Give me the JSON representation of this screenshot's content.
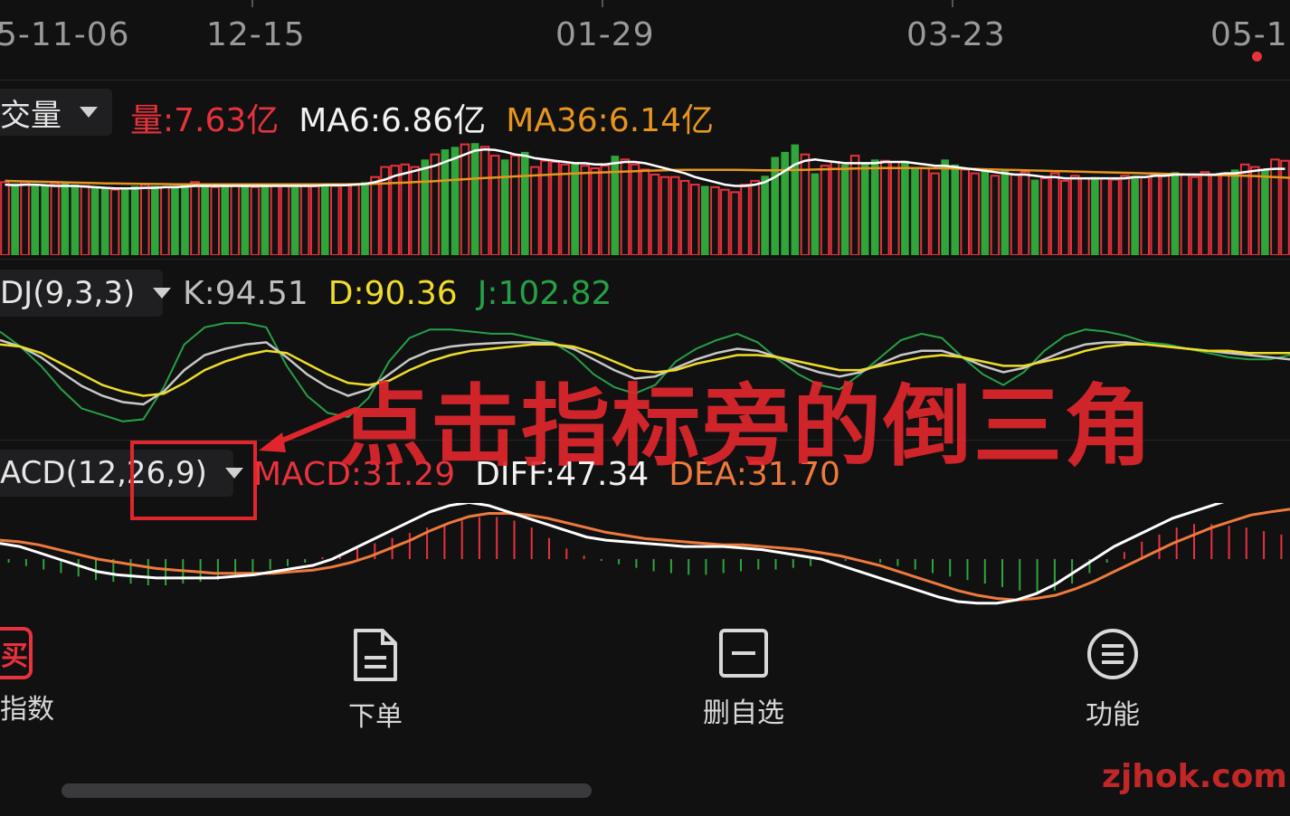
{
  "date_axis": {
    "labels": [
      "5-11-06",
      "12-15",
      "01-29",
      "03-23",
      "05-1"
    ]
  },
  "volume_panel": {
    "selector": "交量",
    "vol_label": "量:7.63亿",
    "ma6_label": "MA6:6.86亿",
    "ma36_label": "MA36:6.14亿"
  },
  "kdj_panel": {
    "selector": "DJ(9,3,3)",
    "k_label": "K:94.51",
    "d_label": "D:90.36",
    "j_label": "J:102.82"
  },
  "macd_panel": {
    "selector": "ACD(12,26,9)",
    "macd_label": "MACD:31.29",
    "diff_label": "DIFF:47.34",
    "dea_label": "DEA:31.70"
  },
  "annotation": {
    "text": "点击指标旁的倒三角"
  },
  "bottom_nav": {
    "index": {
      "icon_char": "买",
      "label": "指数"
    },
    "order": {
      "label": "下单"
    },
    "remove": {
      "label": "删自选"
    },
    "func": {
      "label": "功能"
    }
  },
  "watermark": "zjhok.com",
  "colors": {
    "up": "#e8323c",
    "down": "#2fa53a",
    "ma6": "#ffffff",
    "ma36": "#e6961e",
    "kdj_k": "#c8c8c8",
    "kdj_d": "#f0dc28",
    "kdj_j": "#26a046",
    "macd_diff": "#ffffff",
    "macd_dea": "#ee7a3c",
    "annotation": "#e0262c"
  },
  "chart_data": [
    {
      "type": "bar",
      "name": "volume",
      "unit": "亿",
      "latest": {
        "volume": 7.63,
        "MA6": 6.86,
        "MA36": 6.14
      },
      "values": [
        5.8,
        5.7,
        5.8,
        5.6,
        5.5,
        5.7,
        5.8,
        5.6,
        5.5,
        5.4,
        5.3,
        5.2,
        5.3,
        5.5,
        5.6,
        5.5,
        5.4,
        5.5,
        5.6,
        5.8,
        5.5,
        5.4,
        5.5,
        5.6,
        5.5,
        5.4,
        5.6,
        5.5,
        5.6,
        5.4,
        5.6,
        5.5,
        5.7,
        5.5,
        5.6,
        5.6,
        5.8,
        6.2,
        7.0,
        7.1,
        7.2,
        7.0,
        7.6,
        8.0,
        8.4,
        8.6,
        8.8,
        8.9,
        8.6,
        7.9,
        7.6,
        7.9,
        8.2,
        7.0,
        7.5,
        7.4,
        7.2,
        7.3,
        7.1,
        6.9,
        7.1,
        7.9,
        7.6,
        7.2,
        6.8,
        6.4,
        6.2,
        6.2,
        5.9,
        5.6,
        5.5,
        5.4,
        5.2,
        5.0,
        5.6,
        5.9,
        6.3,
        7.8,
        8.2,
        8.8,
        8.0,
        6.5,
        7.1,
        7.4,
        7.2,
        7.9,
        7.3,
        7.6,
        7.5,
        7.4,
        7.5,
        7.0,
        6.9,
        6.5,
        7.6,
        7.2,
        6.8,
        6.5,
        6.9,
        6.3,
        6.8,
        6.4,
        6.6,
        6.0,
        6.1,
        6.5,
        5.9,
        6.3,
        6.1,
        6.2,
        6.1,
        6.0,
        6.3,
        6.3,
        6.2,
        6.4,
        6.4,
        6.6,
        6.4,
        6.2,
        6.6,
        6.4,
        6.5,
        6.8,
        7.2,
        7.0,
        6.8,
        7.6,
        7.5
      ],
      "up": [
        true,
        false,
        true,
        false,
        false,
        true,
        false,
        false,
        true,
        false,
        false,
        true,
        false,
        false,
        true,
        false,
        true,
        false,
        false,
        true,
        false,
        true,
        false,
        true,
        false,
        true,
        false,
        true,
        true,
        false,
        true,
        true,
        false,
        true,
        true,
        true,
        false,
        true,
        true,
        true,
        true,
        true,
        false,
        true,
        false,
        false,
        true,
        false,
        true,
        true,
        false,
        true,
        false,
        true,
        true,
        true,
        true,
        false,
        true,
        true,
        true,
        false,
        true,
        true,
        true,
        true,
        true,
        true,
        true,
        true,
        false,
        true,
        true,
        true,
        true,
        true,
        false,
        false,
        false,
        false,
        true,
        false,
        true,
        true,
        false,
        true,
        false,
        false,
        true,
        true,
        false,
        false,
        true,
        true,
        false,
        false,
        true,
        true,
        false,
        true,
        false,
        true,
        true,
        false,
        true,
        true,
        true,
        true,
        true,
        false,
        true,
        true,
        true,
        false,
        true,
        true,
        true,
        false,
        true,
        true,
        true,
        true,
        true,
        false,
        true,
        true,
        false,
        true,
        true
      ],
      "ma6": [
        5.6,
        5.55,
        5.6,
        5.6,
        5.55,
        5.5,
        5.5,
        5.5,
        5.45,
        5.4,
        5.35,
        5.3,
        5.3,
        5.3,
        5.35,
        5.35,
        5.4,
        5.4,
        5.45,
        5.5,
        5.5,
        5.5,
        5.5,
        5.5,
        5.5,
        5.5,
        5.5,
        5.5,
        5.5,
        5.5,
        5.5,
        5.5,
        5.55,
        5.55,
        5.55,
        5.6,
        5.65,
        5.8,
        6.0,
        6.3,
        6.5,
        6.7,
        6.9,
        7.1,
        7.4,
        7.7,
        8.0,
        8.3,
        8.4,
        8.35,
        8.2,
        8.0,
        7.9,
        7.7,
        7.6,
        7.5,
        7.4,
        7.3,
        7.3,
        7.2,
        7.2,
        7.3,
        7.4,
        7.4,
        7.3,
        7.1,
        6.9,
        6.7,
        6.5,
        6.2,
        6.0,
        5.8,
        5.6,
        5.5,
        5.5,
        5.6,
        5.8,
        6.2,
        6.7,
        7.2,
        7.5,
        7.6,
        7.5,
        7.4,
        7.3,
        7.3,
        7.3,
        7.3,
        7.4,
        7.4,
        7.4,
        7.3,
        7.2,
        7.1,
        7.1,
        7.0,
        6.9,
        6.8,
        6.7,
        6.6,
        6.5,
        6.4,
        6.4,
        6.3,
        6.2,
        6.2,
        6.1,
        6.1,
        6.1,
        6.1,
        6.1,
        6.1,
        6.1,
        6.2,
        6.2,
        6.3,
        6.3,
        6.4,
        6.4,
        6.4,
        6.4,
        6.4,
        6.5,
        6.5,
        6.6,
        6.7,
        6.8,
        6.86,
        6.86
      ],
      "ma36": [
        5.9,
        5.88,
        5.86,
        5.84,
        5.82,
        5.8,
        5.78,
        5.76,
        5.74,
        5.72,
        5.7,
        5.69,
        5.68,
        5.67,
        5.66,
        5.65,
        5.64,
        5.63,
        5.62,
        5.62,
        5.62,
        5.62,
        5.62,
        5.62,
        5.62,
        5.62,
        5.62,
        5.62,
        5.62,
        5.62,
        5.62,
        5.62,
        5.62,
        5.62,
        5.63,
        5.64,
        5.65,
        5.67,
        5.7,
        5.73,
        5.76,
        5.8,
        5.84,
        5.88,
        5.93,
        5.98,
        6.03,
        6.08,
        6.13,
        6.17,
        6.21,
        6.25,
        6.29,
        6.33,
        6.37,
        6.41,
        6.45,
        6.49,
        6.52,
        6.55,
        6.58,
        6.61,
        6.64,
        6.67,
        6.7,
        6.72,
        6.74,
        6.76,
        6.77,
        6.78,
        6.78,
        6.78,
        6.78,
        6.77,
        6.76,
        6.75,
        6.74,
        6.74,
        6.75,
        6.76,
        6.78,
        6.8,
        6.82,
        6.84,
        6.86,
        6.88,
        6.9,
        6.91,
        6.92,
        6.92,
        6.92,
        6.92,
        6.91,
        6.9,
        6.89,
        6.88,
        6.86,
        6.84,
        6.82,
        6.8,
        6.78,
        6.76,
        6.74,
        6.72,
        6.7,
        6.68,
        6.66,
        6.64,
        6.62,
        6.6,
        6.58,
        6.56,
        6.54,
        6.52,
        6.5,
        6.48,
        6.46,
        6.44,
        6.42,
        6.4,
        6.38,
        6.36,
        6.34,
        6.32,
        6.3,
        6.28,
        6.24,
        6.2,
        6.16,
        6.14
      ]
    },
    {
      "type": "line",
      "name": "KDJ(9,3,3)",
      "latest": {
        "K": 94.51,
        "D": 90.36,
        "J": 102.82
      },
      "series": [
        {
          "name": "K",
          "values": [
            88,
            82,
            72,
            58,
            45,
            36,
            30,
            28,
            40,
            60,
            74,
            80,
            84,
            86,
            72,
            56,
            44,
            36,
            42,
            56,
            70,
            78,
            82,
            84,
            85,
            86,
            86,
            85,
            80,
            70,
            60,
            52,
            54,
            62,
            70,
            76,
            80,
            78,
            72,
            64,
            58,
            54,
            58,
            66,
            74,
            78,
            78,
            72,
            64,
            58,
            62,
            70,
            78,
            84,
            86,
            86,
            84,
            82,
            80,
            78,
            76,
            74,
            72,
            70
          ]
        },
        {
          "name": "D",
          "values": [
            84,
            82,
            76,
            66,
            56,
            46,
            40,
            36,
            38,
            48,
            60,
            68,
            74,
            78,
            76,
            66,
            56,
            48,
            46,
            50,
            60,
            68,
            74,
            78,
            80,
            82,
            84,
            84,
            82,
            76,
            68,
            60,
            58,
            60,
            66,
            70,
            74,
            74,
            72,
            68,
            64,
            60,
            60,
            64,
            68,
            72,
            74,
            72,
            68,
            64,
            64,
            68,
            72,
            78,
            82,
            84,
            84,
            82,
            80,
            78,
            78,
            76,
            76,
            76
          ]
        },
        {
          "name": "J",
          "values": [
            96,
            82,
            64,
            42,
            24,
            18,
            12,
            14,
            44,
            84,
            100,
            104,
            104,
            100,
            64,
            36,
            20,
            16,
            34,
            68,
            90,
            98,
            98,
            96,
            94,
            94,
            90,
            86,
            74,
            56,
            44,
            38,
            46,
            68,
            80,
            88,
            94,
            86,
            70,
            56,
            46,
            42,
            56,
            72,
            88,
            94,
            90,
            72,
            56,
            46,
            58,
            78,
            92,
            98,
            96,
            92,
            86,
            84,
            80,
            76,
            72,
            70,
            70,
            74
          ]
        }
      ],
      "ylim": [
        0,
        110
      ]
    },
    {
      "type": "bar",
      "name": "MACD(12,26,9)",
      "latest": {
        "MACD": 31.29,
        "DIFF": 47.34,
        "DEA": 31.7
      },
      "histogram": [
        -2,
        -4,
        -6,
        -8,
        -10,
        -12,
        -13,
        -14,
        -15,
        -15,
        -14,
        -13,
        -12,
        -10,
        -8,
        -6,
        -4,
        -2,
        1,
        3,
        6,
        9,
        12,
        15,
        18,
        20,
        22,
        24,
        24,
        22,
        18,
        12,
        6,
        2,
        -1,
        -3,
        -5,
        -7,
        -8,
        -9,
        -9,
        -8,
        -7,
        -6,
        -6,
        -5,
        -4,
        -2,
        -1,
        0,
        -2,
        -4,
        -6,
        -8,
        -10,
        -12,
        -14,
        -16,
        -18,
        -19,
        -18,
        -14,
        -8,
        -2,
        4,
        10,
        14,
        18,
        20,
        20,
        19,
        18,
        16,
        14
      ],
      "series": [
        {
          "name": "DIFF",
          "values": [
            10,
            8,
            4,
            0,
            -4,
            -8,
            -10,
            -11,
            -12,
            -12,
            -12,
            -12,
            -11,
            -10,
            -8,
            -6,
            -4,
            0,
            6,
            12,
            18,
            24,
            30,
            34,
            36,
            34,
            30,
            26,
            22,
            18,
            14,
            12,
            11,
            10,
            9,
            8,
            8,
            8,
            7,
            6,
            4,
            2,
            0,
            -4,
            -8,
            -12,
            -16,
            -20,
            -24,
            -27,
            -28,
            -28,
            -26,
            -22,
            -16,
            -8,
            0,
            8,
            14,
            20,
            26,
            30,
            34,
            38,
            42,
            45,
            47
          ]
        },
        {
          "name": "DEA",
          "values": [
            12,
            11,
            9,
            6,
            3,
            0,
            -2,
            -4,
            -6,
            -7,
            -8,
            -9,
            -9,
            -9,
            -9,
            -8,
            -7,
            -5,
            -2,
            2,
            7,
            12,
            18,
            23,
            27,
            29,
            29,
            28,
            26,
            23,
            20,
            17,
            15,
            13,
            12,
            11,
            10,
            9,
            9,
            8,
            7,
            6,
            4,
            2,
            -1,
            -4,
            -8,
            -12,
            -16,
            -20,
            -23,
            -25,
            -26,
            -25,
            -23,
            -19,
            -14,
            -8,
            -2,
            4,
            10,
            15,
            20,
            24,
            28,
            30,
            31.7
          ]
        }
      ]
    }
  ]
}
